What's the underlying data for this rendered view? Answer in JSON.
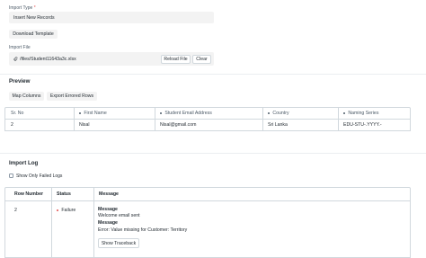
{
  "import_type": {
    "label": "Import Type",
    "required_mark": "*",
    "value": "Insert New Records"
  },
  "download_template_label": "Download Template",
  "import_file": {
    "label": "Import File",
    "value": "/files/Student11643a3c.xlsx",
    "reload_label": "Reload File",
    "clear_label": "Clear"
  },
  "preview": {
    "title": "Preview",
    "map_columns_label": "Map Columns",
    "export_errored_label": "Export Errored Rows",
    "columns": [
      "Sr. No",
      "First Name",
      "Student Email Address",
      "Country",
      "Naming Series"
    ],
    "rows": [
      [
        "2",
        "Nisal",
        "Nisal@gmail.com",
        "Sri Lanka",
        "EDU-STU-.YYYY.-"
      ]
    ]
  },
  "import_log": {
    "title": "Import Log",
    "show_failed_label": "Show Only Failed Logs",
    "columns": [
      "Row Number",
      "Status",
      "Message"
    ],
    "rows": [
      {
        "row_number": "2",
        "status": "Failure",
        "status_color": "#e24c4c",
        "message_title_1": "Message",
        "message_text_1": "Welcome email sent",
        "message_title_2": "Message",
        "message_text_2": "Error: Value missing for Customer: Territory",
        "traceback_label": "Show Traceback"
      }
    ]
  }
}
